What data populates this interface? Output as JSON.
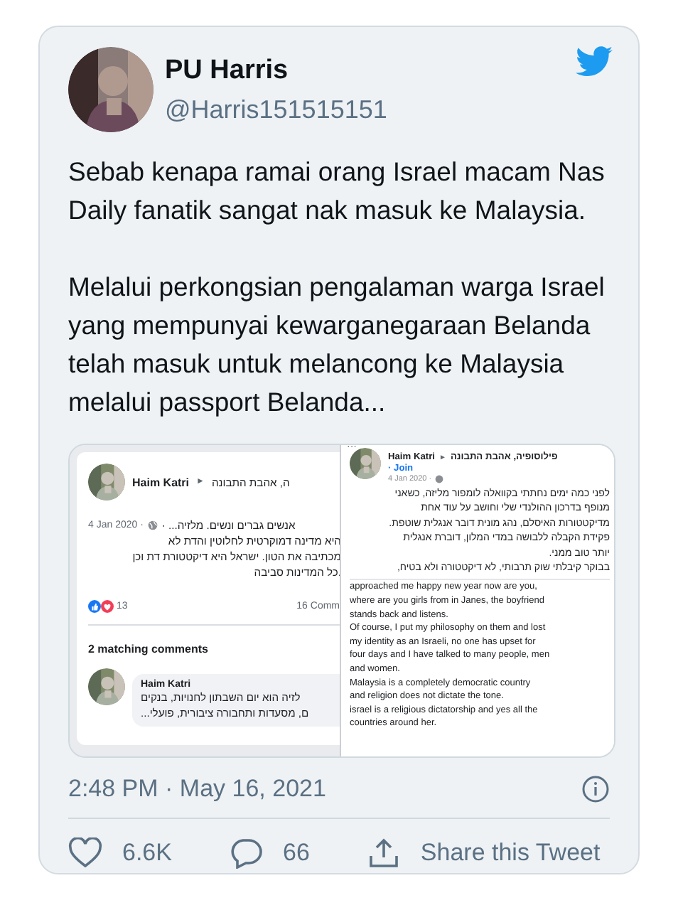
{
  "tweet": {
    "author": {
      "name": "PU Harris",
      "handle": "@Harris151515151"
    },
    "paragraphs": [
      "Sebab kenapa ramai orang Israel macam Nas Daily fanatik sangat nak masuk ke Malaysia.",
      "Melalui perkongsian pengalaman warga Israel yang mempunyai kewarganegaraan Belanda telah masuk untuk melancong ke Malaysia melalui passport Belanda..."
    ],
    "embedded_image": {
      "left_post": {
        "author": "Haim Katri",
        "arrow": "►",
        "group": "ה, אהבת התבונה",
        "date": "4 Jan 2020 ·",
        "first_line": "אנשים גברים ונשים. מלזיה... ·",
        "lines": [
          "היא מדינה דמוקרטית לחלוטין והדת לא",
          "מכתיבה את הטון. ישראל היא דיקטטורת דת וכן",
          ".כל המדינות סביבה"
        ],
        "reaction_count": "13",
        "comments_count": "16 Comm",
        "matching_comments": "2 matching comments",
        "comment": {
          "author": "Haim Katri",
          "lines": [
            "לזיה הוא יום השבתון לחנויות, בנקים",
            "ם, מסעדות ותחבורה ציבורית, פועלי..."
          ]
        }
      },
      "right_post": {
        "more": "···",
        "author": "Haim Katri",
        "arrow": "►",
        "group": "פילוסופיה, אהבת התבונה",
        "join": "· Join",
        "date": "4 Jan 2020 ·",
        "hebrew_lines": [
          "לפני כמה ימים נחתתי בקוואלה לומפור מליזה, כשאני",
          "מנופף בדרכון ההולנדי שלי  וחושב על עוד אחת",
          "מדיקטטורות האיסלם, נהג מונית דובר אנגלית שוטפת.",
          "פקידת הקבלה ללבושה במדי המלון, דוברת אנגלית",
          "יותר טוב ממני.",
          "בבוקר קיבלתי שוק תרבותי, לא דיקטטורה ולא בטיח,"
        ],
        "english_lines": [
          "approached me happy new year now are you,",
          "where are you girls from in Janes, the boyfriend",
          "stands back and listens.",
          "Of course, I put my philosophy on them and lost",
          "my identity as an Israeli, no one has upset for",
          "four days and I have talked to many people, men",
          "and women.",
          "Malaysia is a completely democratic country",
          "and religion does not dictate the tone.",
          "israel is a religious dictatorship and yes all the",
          "countries around her."
        ]
      }
    },
    "timestamp": "2:48 PM · May 16, 2021",
    "like_count": "6.6K",
    "reply_count": "66",
    "share_label": "Share this Tweet"
  }
}
